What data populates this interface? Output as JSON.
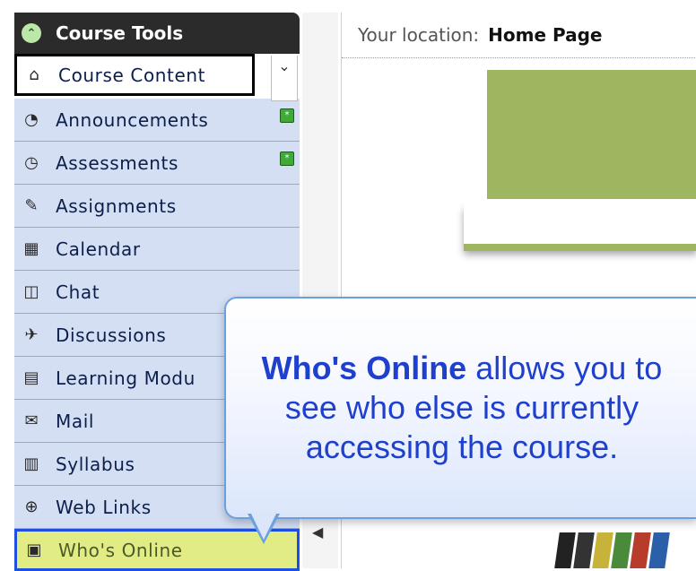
{
  "sidebar": {
    "title": "Course Tools",
    "scroll_icon": "chevron-double-down-icon",
    "items": [
      {
        "label": "Course Content",
        "icon": "home-icon",
        "glyph": "⌂",
        "badge": ""
      },
      {
        "label": "Announcements",
        "icon": "announcement-icon",
        "glyph": "◔",
        "badge": "*"
      },
      {
        "label": "Assessments",
        "icon": "assessment-icon",
        "glyph": "◷",
        "badge": "*"
      },
      {
        "label": "Assignments",
        "icon": "assignment-icon",
        "glyph": "✎",
        "badge": ""
      },
      {
        "label": "Calendar",
        "icon": "calendar-icon",
        "glyph": "▦",
        "badge": ""
      },
      {
        "label": "Chat",
        "icon": "chat-icon",
        "glyph": "◫",
        "badge": ""
      },
      {
        "label": "Discussions",
        "icon": "discussion-icon",
        "glyph": "✈",
        "badge": ""
      },
      {
        "label": "Learning Modu",
        "icon": "learning-module-icon",
        "glyph": "▤",
        "badge": ""
      },
      {
        "label": "Mail",
        "icon": "mail-icon",
        "glyph": "✉",
        "badge": ""
      },
      {
        "label": "Syllabus",
        "icon": "syllabus-icon",
        "glyph": "▥",
        "badge": ""
      },
      {
        "label": "Web Links",
        "icon": "web-link-icon",
        "glyph": "⊕",
        "badge": ""
      },
      {
        "label": "Who's Online",
        "icon": "who-online-icon",
        "glyph": "▣",
        "badge": ""
      }
    ]
  },
  "location": {
    "prefix": "Your location:",
    "page": "Home Page"
  },
  "callout": {
    "highlight": "Who's Online",
    "text": " allows you to see who else is currently accessing the course."
  },
  "colors": {
    "sidebar_item_bg": "#d5dff4",
    "selected_bg": "#e1ec84",
    "banner_green": "#9fb661",
    "callout_text": "#1e40cc"
  }
}
